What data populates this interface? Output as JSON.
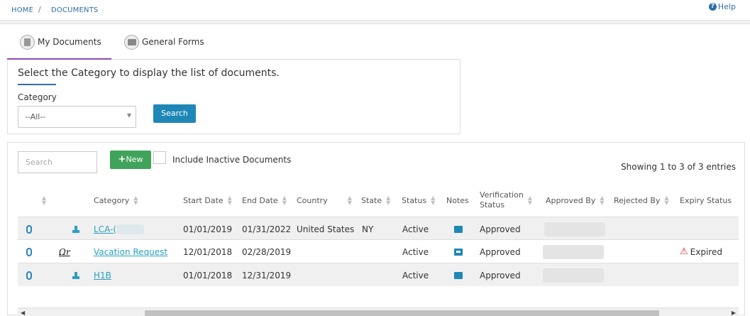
{
  "breadcrumb": {
    "home": "HOME",
    "separator": "/",
    "current": "DOCUMENTS"
  },
  "help": {
    "icon": "?",
    "label": "Help"
  },
  "tabs": [
    {
      "label": "My Documents",
      "icon": "document-icon",
      "active": true
    },
    {
      "label": "General Forms",
      "icon": "folder-icon",
      "active": false
    }
  ],
  "filter": {
    "title": "Select the Category to display the list of documents.",
    "category_label": "Category",
    "category_value": "--All--",
    "search_button": "Search"
  },
  "list": {
    "search_placeholder": "Search",
    "new_button": "New",
    "include_inactive_label": "Include Inactive Documents",
    "include_inactive_checked": false,
    "showing": "Showing 1 to 3 of 3 entries"
  },
  "table": {
    "columns": [
      "Category",
      "Start Date",
      "End Date",
      "Country",
      "State",
      "Status",
      "Notes",
      "Verification Status",
      "Approved By",
      "Rejected By",
      "Expiry Status"
    ],
    "verification_line1": "Verification",
    "verification_line2": "Status",
    "rows": [
      {
        "category": "LCA-(",
        "start_date": "01/01/2019",
        "end_date": "01/31/2022",
        "country": "United States",
        "state": "NY",
        "status": "Active",
        "verification": "Approved",
        "approved_by": "",
        "rejected_by": "",
        "expiry": ""
      },
      {
        "category": "Vacation Request",
        "start_date": "12/01/2018",
        "end_date": "02/28/2019",
        "country": "",
        "state": "",
        "status": "Active",
        "verification": "Approved",
        "approved_by": "",
        "rejected_by": "",
        "expiry": "Expired"
      },
      {
        "category": "H1B",
        "start_date": "01/01/2018",
        "end_date": "12/31/2019",
        "country": "",
        "state": "",
        "status": "Active",
        "verification": "Approved",
        "approved_by": "",
        "rejected_by": "",
        "expiry": ""
      }
    ]
  },
  "colors": {
    "link": "#2aa0c2",
    "primary": "#1f87b8",
    "success": "#3fa35b",
    "tab_active": "#8b4bb5",
    "danger": "#d12f2f"
  }
}
